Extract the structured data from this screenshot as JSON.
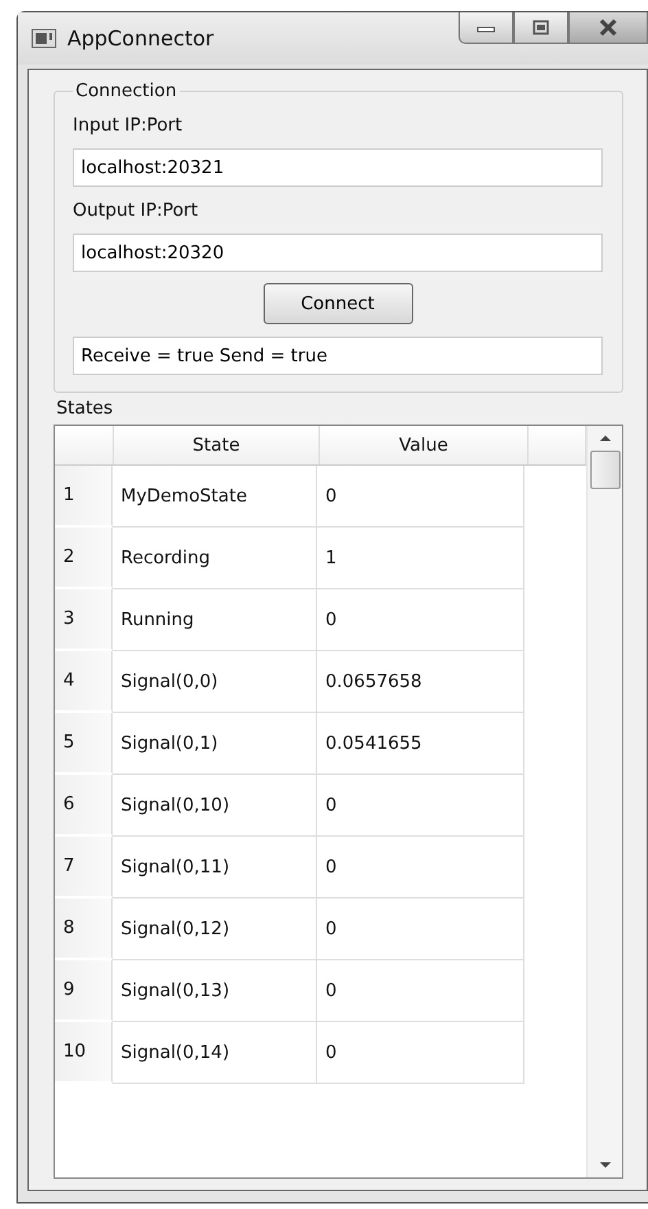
{
  "window": {
    "title": "AppConnector"
  },
  "connection": {
    "title": "Connection",
    "input_label": "Input IP:Port",
    "input_value": "localhost:20321",
    "output_label": "Output IP:Port",
    "output_value": "localhost:20320",
    "connect_button": "Connect",
    "status": "Receive = true Send = true"
  },
  "states": {
    "title": "States",
    "columns": [
      "State",
      "Value"
    ],
    "rows": [
      {
        "index": "1",
        "state": "MyDemoState",
        "value": "0"
      },
      {
        "index": "2",
        "state": "Recording",
        "value": "1"
      },
      {
        "index": "3",
        "state": "Running",
        "value": "0"
      },
      {
        "index": "4",
        "state": "Signal(0,0)",
        "value": "0.0657658"
      },
      {
        "index": "5",
        "state": "Signal(0,1)",
        "value": "0.0541655"
      },
      {
        "index": "6",
        "state": "Signal(0,10)",
        "value": "0"
      },
      {
        "index": "7",
        "state": "Signal(0,11)",
        "value": "0"
      },
      {
        "index": "8",
        "state": "Signal(0,12)",
        "value": "0"
      },
      {
        "index": "9",
        "state": "Signal(0,13)",
        "value": "0"
      },
      {
        "index": "10",
        "state": "Signal(0,14)",
        "value": "0"
      }
    ]
  }
}
